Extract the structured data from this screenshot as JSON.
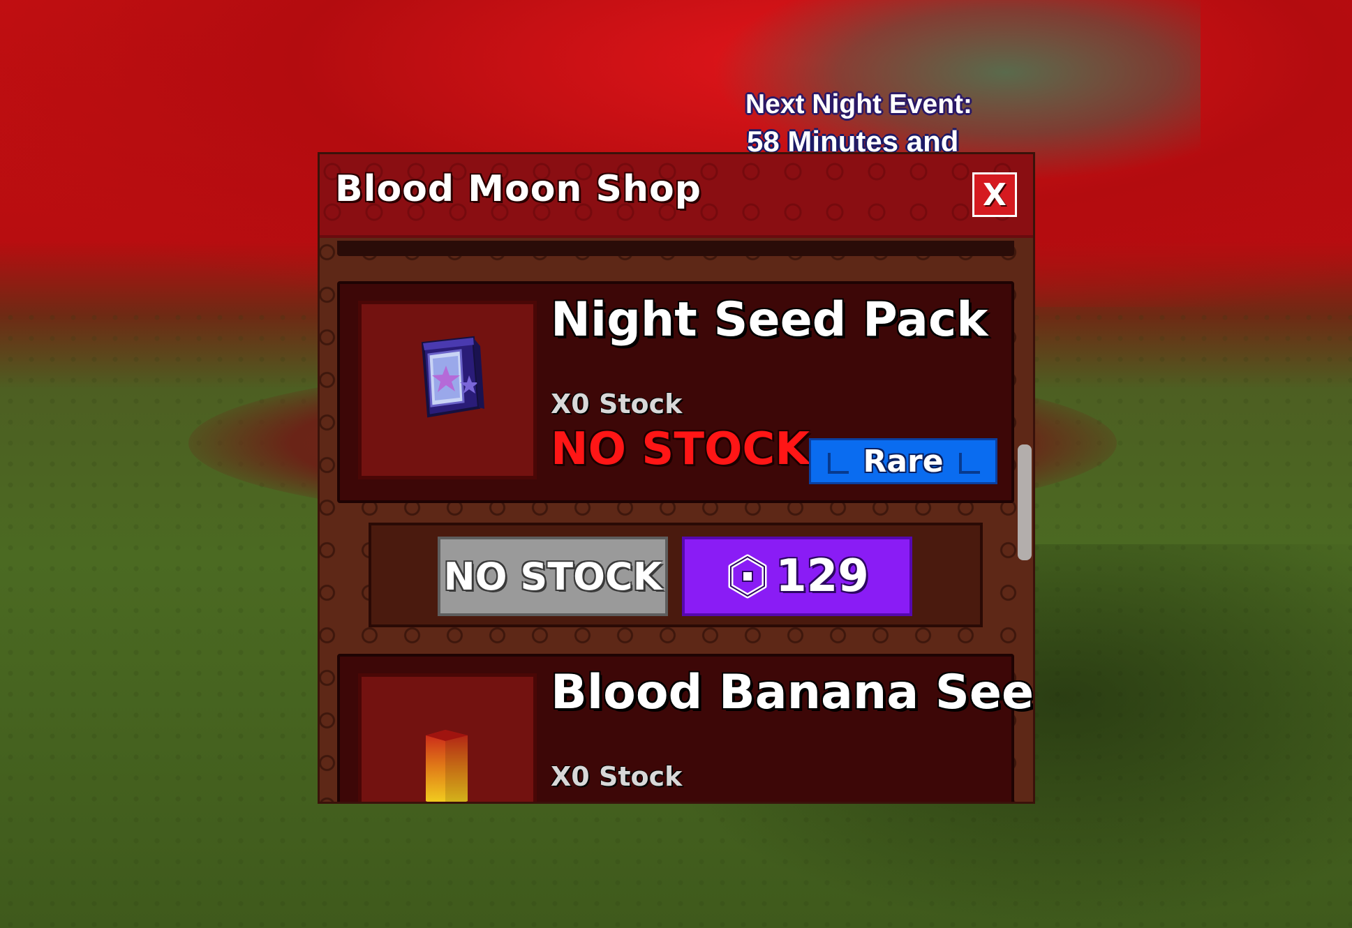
{
  "event_banner": {
    "label": "Next Night Event:",
    "time": "58 Minutes and"
  },
  "shop": {
    "title": "Blood Moon Shop",
    "close_label": "X",
    "items": [
      {
        "name": "Night Seed Pack",
        "stock": "X0 Stock",
        "status": "NO STOCK",
        "rarity": "Rare",
        "icon": "seed-pack-icon"
      },
      {
        "name": "Blood Banana Seed",
        "stock": "X0 Stock",
        "icon": "blood-banana-seed-icon"
      }
    ],
    "buy": {
      "no_stock_label": "NO STOCK",
      "price": "129",
      "currency_icon": "robux-icon"
    }
  },
  "colors": {
    "header_red": "#b0161c",
    "no_stock_red": "#ff1616",
    "rarity_blue": "#0a6cf0",
    "price_purple": "#8a1cf5",
    "no_stock_gray": "#9a9a9a"
  }
}
